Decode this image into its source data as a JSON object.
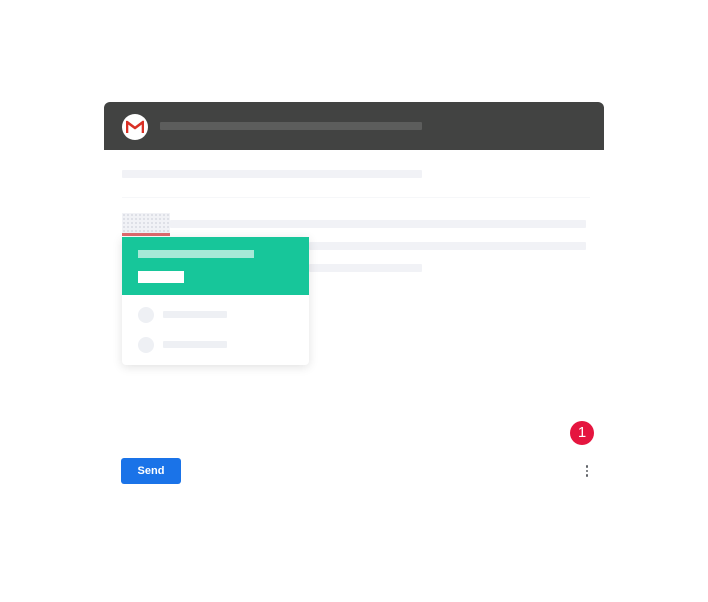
{
  "app": {
    "logo_icon": "gmail-logo-icon",
    "colors": {
      "header": "#424342",
      "card_accent": "#17c69a",
      "send": "#1a73e8",
      "badge": "#e5153f",
      "tag_underline": "#e06a6e"
    }
  },
  "compose": {
    "send_label": "Send",
    "more_icon": "more-vert-icon"
  },
  "badge": {
    "count": "1"
  }
}
